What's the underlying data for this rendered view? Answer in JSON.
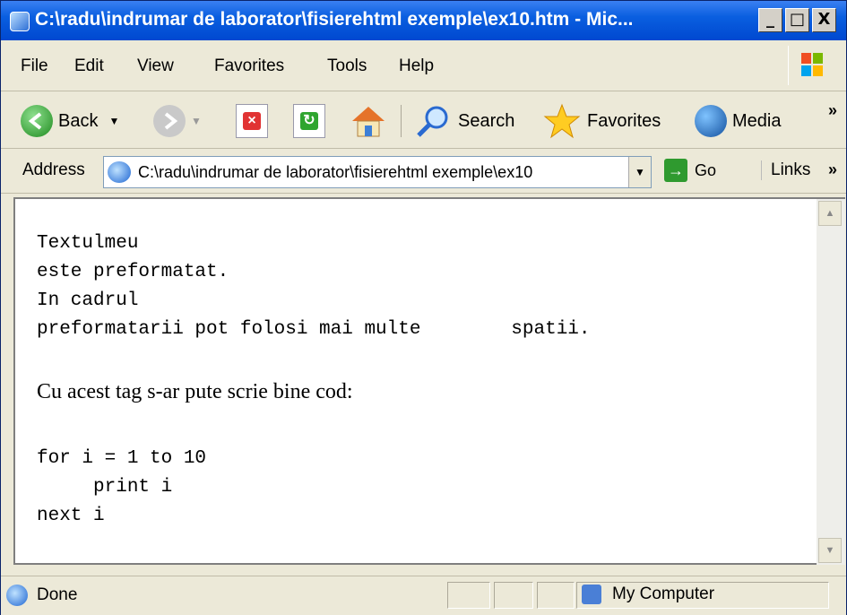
{
  "window": {
    "title": "C:\\radu\\indrumar de laborator\\fisierehtml exemple\\ex10.htm - Mic...",
    "controls": {
      "minimize": "_",
      "maximize": "□",
      "close": "X"
    }
  },
  "menu": [
    "File",
    "Edit",
    "View",
    "Favorites",
    "Tools",
    "Help"
  ],
  "toolbar": {
    "back": "Back",
    "search": "Search",
    "favorites": "Favorites",
    "media": "Media",
    "more": "»"
  },
  "address": {
    "label": "Address",
    "value": "C:\\radu\\indrumar de laborator\\fisierehtml exemple\\ex10",
    "go": "Go",
    "links": "Links",
    "more": "»"
  },
  "content": {
    "pre1": "Textulmeu\neste preformatat.\nIn cadrul\npreformatarii pot folosi mai multe        spatii.",
    "paragraph": "Cu acest tag s-ar pute scrie bine cod:",
    "pre2": "for i = 1 to 10\n     print i\nnext i"
  },
  "status": {
    "text": "Done",
    "zone": "My Computer"
  }
}
